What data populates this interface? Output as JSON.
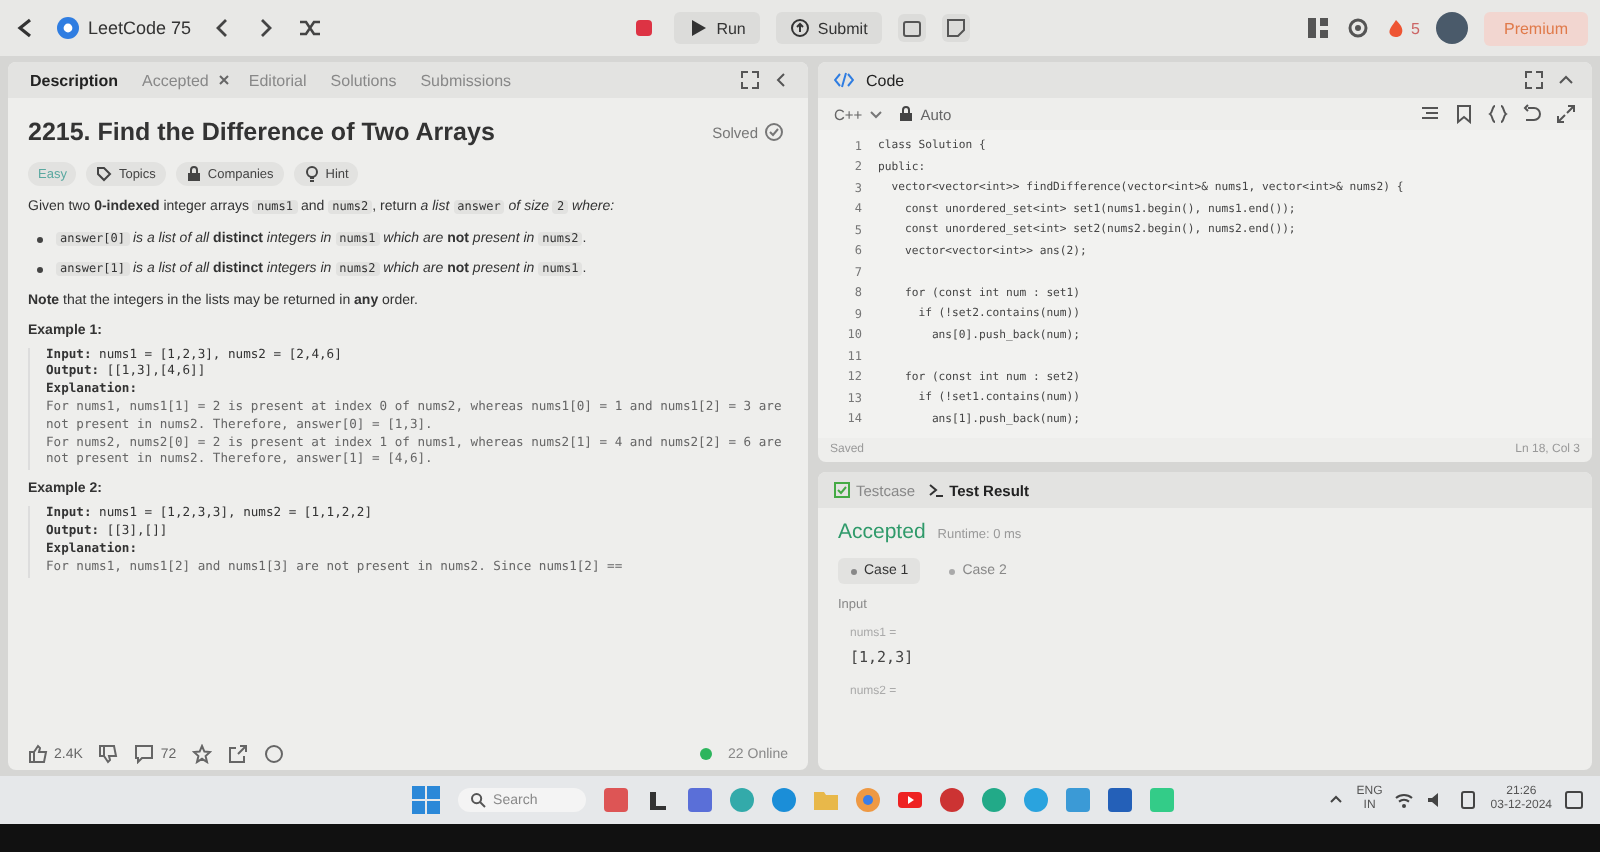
{
  "nav": {
    "list_title": "LeetCode 75",
    "run": "Run",
    "submit": "Submit",
    "streak": "5",
    "premium": "Premium"
  },
  "left_tabs": [
    {
      "label": "Description",
      "selected": true,
      "closable": false
    },
    {
      "label": "Accepted",
      "selected": false,
      "closable": true
    },
    {
      "label": "Editorial",
      "selected": false,
      "closable": false
    },
    {
      "label": "Solutions",
      "selected": false,
      "closable": false
    },
    {
      "label": "Submissions",
      "selected": false,
      "closable": false
    }
  ],
  "problem": {
    "title": "2215. Find the Difference of Two Arrays",
    "status": "Solved",
    "tags": [
      {
        "label": "Easy",
        "kind": "difficulty"
      },
      {
        "label": "Topics",
        "kind": "topics"
      },
      {
        "label": "Companies",
        "kind": "companies"
      },
      {
        "label": "Hint",
        "kind": "hint"
      }
    ],
    "intro": [
      {
        "text": "Given two **0-indexed** integer arrays "
      },
      {
        "code": "nums1"
      },
      {
        "text": " and "
      },
      {
        "code": "nums2"
      },
      {
        "text": ", return *a list* "
      },
      {
        "code": "answer"
      },
      {
        "text": " *of size* "
      },
      {
        "code": "2"
      },
      {
        "text": " *where:*"
      }
    ],
    "bullets": [
      [
        {
          "code": "answer[0]"
        },
        {
          "text": " *is a list of all* **distinct** *integers in* "
        },
        {
          "code": "nums1"
        },
        {
          "text": " *which are* **not** *present in* "
        },
        {
          "code": "nums2"
        },
        {
          "text": "."
        }
      ],
      [
        {
          "code": "answer[1]"
        },
        {
          "text": " *is a list of all* **distinct** *integers in* "
        },
        {
          "code": "nums2"
        },
        {
          "text": " *which are* **not** *present in* "
        },
        {
          "code": "nums1"
        },
        {
          "text": "."
        }
      ]
    ],
    "note": "**Note** that the integers in the lists may be returned in **any** order.",
    "examples": [
      {
        "heading": "Example 1:",
        "lines": [
          {
            "kind": "io",
            "text": "**Input:** nums1 = [1,2,3], nums2 = [2,4,6]"
          },
          {
            "kind": "io",
            "text": "**Output:** [[1,3],[4,6]]"
          },
          {
            "kind": "heading",
            "text": "Explanation:"
          },
          {
            "kind": "text",
            "text": "For nums1, nums1[1] = 2 is present at index 0 of nums2, whereas nums1[0] = 1 and nums1[2] = 3 are not present in nums2. Therefore, answer[0] = [1,3]."
          },
          {
            "kind": "text",
            "text": "For nums2, nums2[0] = 2 is present at index 1 of nums1, whereas nums2[1] = 4 and nums2[2] = 6 are not present in nums2. Therefore, answer[1] = [4,6]."
          }
        ]
      },
      {
        "heading": "Example 2:",
        "lines": [
          {
            "kind": "io",
            "text": "**Input:** nums1 = [1,2,3,3], nums2 = [1,1,2,2]"
          },
          {
            "kind": "io",
            "text": "**Output:** [[3],[]]"
          },
          {
            "kind": "heading",
            "text": "Explanation:"
          },
          {
            "kind": "text",
            "text": "For nums1, nums1[2] and nums1[3] are not present in nums2. Since nums1[2] =="
          }
        ]
      }
    ]
  },
  "footer": {
    "likes": "2.4K",
    "comments": "72",
    "online": "22 Online"
  },
  "code_panel": {
    "title": "Code",
    "language": "C++",
    "mode": "Auto",
    "status": "Saved",
    "cursor": "Ln 18, Col 3",
    "lines": [
      {
        "num": "1",
        "code": "class Solution {"
      },
      {
        "num": "2",
        "code": "public:"
      },
      {
        "num": "3",
        "code": "  vector<vector<int>> findDifference(vector<int>& nums1, vector<int>& nums2) {"
      },
      {
        "num": "4",
        "code": "    const unordered_set<int> set1(nums1.begin(), nums1.end());"
      },
      {
        "num": "5",
        "code": "    const unordered_set<int> set2(nums2.begin(), nums2.end());"
      },
      {
        "num": "6",
        "code": "    vector<vector<int>> ans(2);"
      },
      {
        "num": "7"
      },
      {
        "num": "8",
        "code": "    for (const int num : set1)"
      },
      {
        "num": "9",
        "code": "      if (!set2.contains(num))"
      },
      {
        "num": "10",
        "code": "        ans[0].push_back(num);"
      },
      {
        "num": "11"
      },
      {
        "num": "12",
        "code": "    for (const int num : set2)"
      },
      {
        "num": "13",
        "code": "      if (!set1.contains(num))"
      },
      {
        "num": "14",
        "code": "        ans[1].push_back(num);"
      }
    ]
  },
  "test_panel": {
    "tabs": [
      {
        "label": "Testcase",
        "selected": false,
        "kind": "testcase"
      },
      {
        "label": "Test Result",
        "selected": true,
        "kind": "result"
      }
    ],
    "verdict": "Accepted",
    "runtime": "Runtime: 0 ms",
    "cases": [
      {
        "label": "Case 1",
        "selected": true
      },
      {
        "label": "Case 2",
        "selected": false
      }
    ],
    "input_label": "Input",
    "params": [
      {
        "name": "nums1 =",
        "value": "[1,2,3]"
      },
      {
        "name": "nums2 ="
      }
    ]
  },
  "taskbar": {
    "search": "Search",
    "lang": "ENG",
    "region": "IN",
    "time": "21:26",
    "date": "03-12-2024"
  }
}
